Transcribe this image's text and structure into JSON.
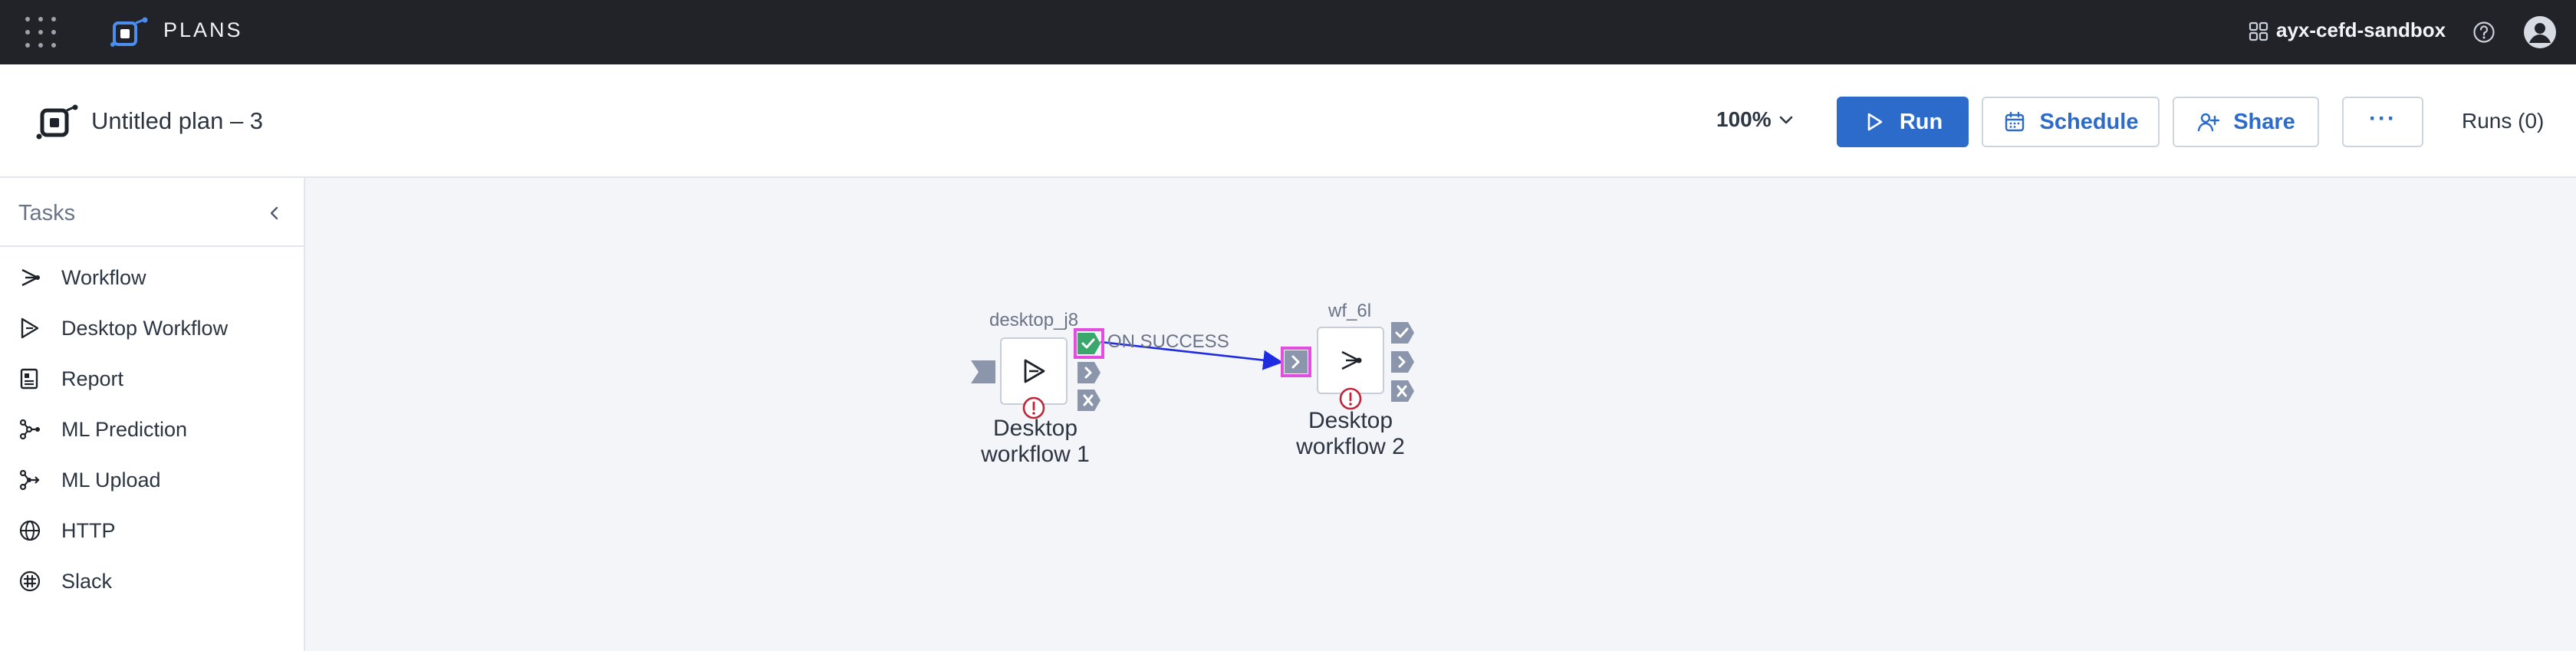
{
  "topbar": {
    "brand": "PLANS",
    "workspace": "ayx-cefd-sandbox"
  },
  "header": {
    "plan_title": "Untitled plan – 3",
    "zoom": "100%",
    "run_label": "Run",
    "schedule_label": "Schedule",
    "share_label": "Share",
    "more_label": "···",
    "runs_label": "Runs (0)"
  },
  "sidebar": {
    "title": "Tasks",
    "items": [
      {
        "label": "Workflow",
        "icon": "workflow-icon"
      },
      {
        "label": "Desktop Workflow",
        "icon": "desktop-workflow-icon"
      },
      {
        "label": "Report",
        "icon": "report-icon"
      },
      {
        "label": "ML Prediction",
        "icon": "ml-prediction-icon"
      },
      {
        "label": "ML Upload",
        "icon": "ml-upload-icon"
      },
      {
        "label": "HTTP",
        "icon": "globe-icon"
      },
      {
        "label": "Slack",
        "icon": "slack-icon"
      }
    ]
  },
  "canvas": {
    "nodes": [
      {
        "id": "desktop_j8",
        "label_line1": "Desktop",
        "label_line2": "workflow 1"
      },
      {
        "id": "wf_6l",
        "label_line1": "Desktop",
        "label_line2": "workflow 2"
      }
    ],
    "edge_label": "ON SUCCESS"
  },
  "colors": {
    "topbar_bg": "#212328",
    "primary": "#2d6bca",
    "canvas_bg": "#f4f5f9",
    "port": "#8b95ab",
    "success": "#3aa76d",
    "error": "#c0263a",
    "highlight": "#e24fe0",
    "edge": "#1f2be0"
  }
}
